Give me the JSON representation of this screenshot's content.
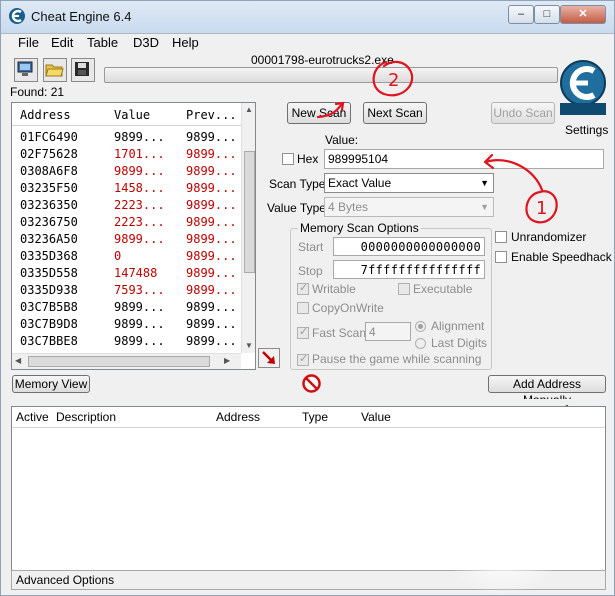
{
  "window": {
    "title": "Cheat Engine 6.4",
    "minimize_glyph": "–",
    "maximize_glyph": "□",
    "close_glyph": "✕"
  },
  "menu": [
    "File",
    "Edit",
    "Table",
    "D3D",
    "Help"
  ],
  "toolbar": {
    "open_process_icon": "computer-icon",
    "open_file_icon": "folder-open-icon",
    "save_icon": "floppy-disk-icon"
  },
  "process_title": "00001798-eurotrucks2.exe",
  "found_label": "Found: 21",
  "settings_label": "Settings",
  "results": {
    "headers": [
      "Address",
      "Value",
      "Prev..."
    ],
    "rows": [
      {
        "address": "01FC6490",
        "value": "9899...",
        "prev": "9899...",
        "changed": false
      },
      {
        "address": "02F75628",
        "value": "1701...",
        "prev": "9899...",
        "changed": true
      },
      {
        "address": "0308A6F8",
        "value": "9899...",
        "prev": "9899...",
        "changed": true
      },
      {
        "address": "03235F50",
        "value": "1458...",
        "prev": "9899...",
        "changed": true
      },
      {
        "address": "03236350",
        "value": "2223...",
        "prev": "9899...",
        "changed": true
      },
      {
        "address": "03236750",
        "value": "2223...",
        "prev": "9899...",
        "changed": true
      },
      {
        "address": "03236A50",
        "value": "9899...",
        "prev": "9899...",
        "changed": true
      },
      {
        "address": "0335D368",
        "value": "0",
        "prev": "9899...",
        "changed": true
      },
      {
        "address": "0335D558",
        "value": "147488",
        "prev": "9899...",
        "changed": true
      },
      {
        "address": "0335D938",
        "value": "7593...",
        "prev": "9899...",
        "changed": true
      },
      {
        "address": "03C7B5B8",
        "value": "9899...",
        "prev": "9899...",
        "changed": false
      },
      {
        "address": "03C7B9D8",
        "value": "9899...",
        "prev": "9899...",
        "changed": false
      },
      {
        "address": "03C7BBE8",
        "value": "9899...",
        "prev": "9899...",
        "changed": false
      }
    ]
  },
  "scan": {
    "new_scan_label": "New Scan",
    "next_scan_label": "Next Scan",
    "undo_scan_label": "Undo Scan",
    "value_label": "Value:",
    "hex_label": "Hex",
    "hex_checked": false,
    "value_input": "989995104",
    "scan_type_label": "Scan Type",
    "scan_type_value": "Exact Value",
    "value_type_label": "Value Type",
    "value_type_value": "4 Bytes"
  },
  "memory_options": {
    "title": "Memory Scan Options",
    "start_label": "Start",
    "start_value": "0000000000000000",
    "stop_label": "Stop",
    "stop_value": "7fffffffffffffff",
    "writable_label": "Writable",
    "writable_checked": true,
    "executable_label": "Executable",
    "executable_checked": false,
    "copyonwrite_label": "CopyOnWrite",
    "copyonwrite_checked": false,
    "fastscan_label": "Fast Scan",
    "fastscan_checked": true,
    "fastscan_value": "4",
    "alignment_label": "Alignment",
    "alignment_selected": true,
    "lastdigits_label": "Last Digits",
    "lastdigits_selected": false,
    "pause_label": "Pause the game while scanning",
    "pause_checked": true
  },
  "extra_options": {
    "unrandomizer_label": "Unrandomizer",
    "unrandomizer_checked": false,
    "speedhack_label": "Enable Speedhack",
    "speedhack_checked": false
  },
  "memory_view_label": "Memory View",
  "add_address_label": "Add Address Manually",
  "stop_icon": "no-entry-icon",
  "add_arrow_icon": "red-arrow-icon",
  "address_list": {
    "headers": [
      "Active",
      "Description",
      "Address",
      "Type",
      "Value"
    ]
  },
  "advanced_options_label": "Advanced Options",
  "annotations": {
    "circle_1": "1",
    "circle_2": "2",
    "color": "#e0141e"
  }
}
